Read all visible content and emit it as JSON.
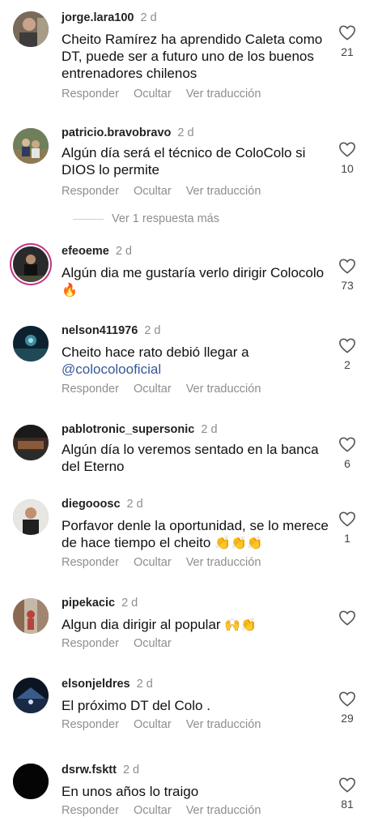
{
  "action_labels": {
    "reply": "Responder",
    "hide": "Ocultar",
    "translate": "Ver traducción"
  },
  "view_more_replies": "Ver 1 respuesta más",
  "comments": [
    {
      "username": "jorge.lara100",
      "time": "2 d",
      "text": "Cheito Ramírez ha aprendido Caleta como DT, puede ser a futuro uno de los buenos entrenadores chilenos",
      "likes": "21",
      "show_translate": true
    },
    {
      "username": "patricio.bravobravo",
      "time": "2 d",
      "text": "Algún día será el técnico de ColoColo si DIOS lo permite",
      "likes": "10",
      "show_translate": true
    },
    {
      "username": "efeoeme",
      "time": "2 d",
      "text": "Algún dia me gustaría verlo dirigir Colocolo",
      "emoji": "🔥",
      "likes": "73",
      "show_translate": false
    },
    {
      "username": "nelson411976",
      "time": "2 d",
      "text": "Cheito hace rato debió llegar a",
      "mention": "@colocolooficial",
      "likes": "2",
      "show_translate": true
    },
    {
      "username": "pablotronic_supersonic",
      "time": "2 d",
      "text": "Algún día lo veremos sentado en la banca del Eterno",
      "likes": "6",
      "show_translate": false
    },
    {
      "username": "diegooosc",
      "time": "2 d",
      "text": "Porfavor denle la oportunidad, se lo merece de hace tiempo el cheito",
      "emoji": "👏👏👏",
      "likes": "1",
      "show_translate": true
    },
    {
      "username": "pipekacic",
      "time": "2 d",
      "text": "Algun dia dirigir al popular",
      "emoji": "🙌👏",
      "likes": "",
      "show_translate": false
    },
    {
      "username": "elsonjeldres",
      "time": "2 d",
      "text": "El próximo DT del Colo .",
      "likes": "29",
      "show_translate": true
    },
    {
      "username": "dsrw.fsktt",
      "time": "2 d",
      "text": "En unos años lo traigo",
      "likes": "81",
      "show_translate": true
    }
  ],
  "icons": {
    "like": "heart-outline-icon"
  },
  "colors": {
    "mention": "#385898",
    "muted": "#8e8e8e",
    "story_ring": "#c13584"
  }
}
